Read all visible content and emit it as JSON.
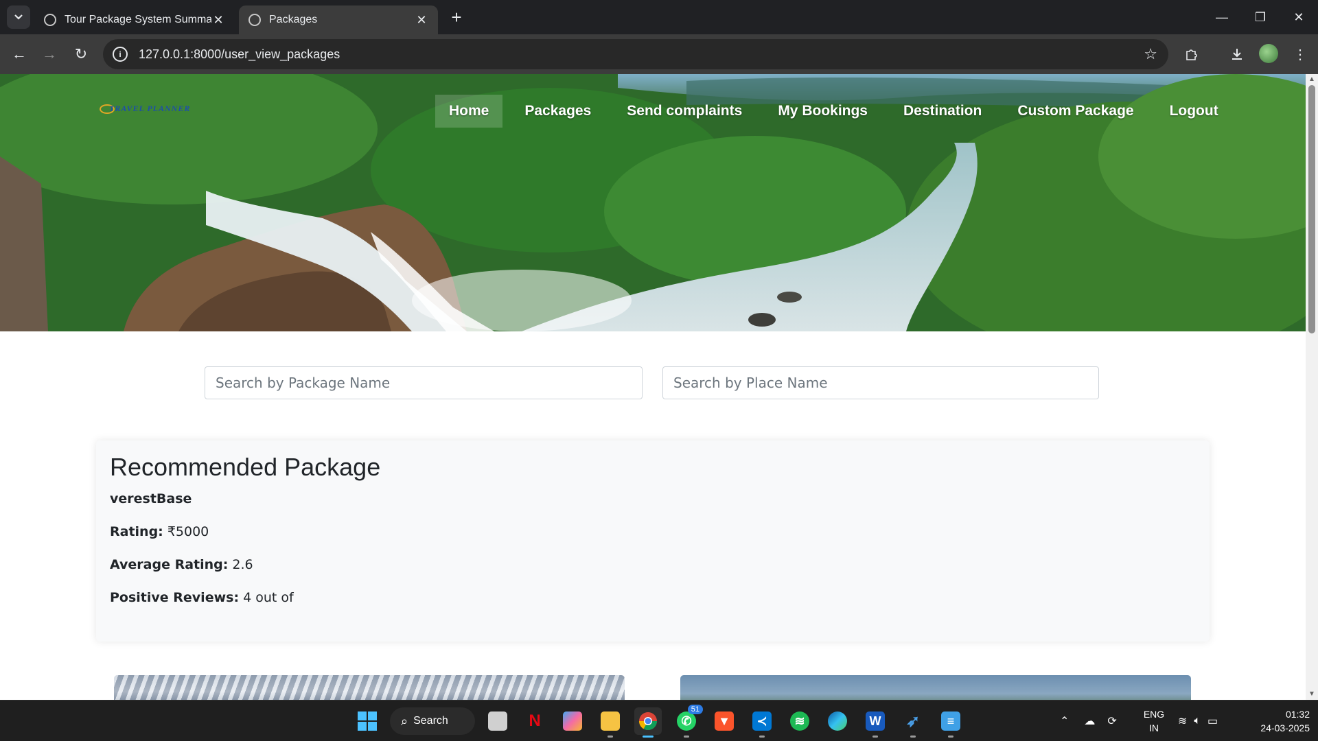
{
  "browser": {
    "tabs": [
      {
        "title": "Tour Package System Summary",
        "active": false
      },
      {
        "title": "Packages",
        "active": true
      }
    ],
    "url": "127.0.0.1:8000/user_view_packages",
    "icons": {
      "tab_list": "chevron-down-icon",
      "new_tab": "plus-icon",
      "back": "arrow-left-icon",
      "forward": "arrow-right-icon",
      "reload": "reload-icon",
      "site_info": "info-icon",
      "bookmark": "star-icon",
      "extensions": "puzzle-icon",
      "downloads": "download-icon",
      "menu": "kebab-menu-icon"
    }
  },
  "site": {
    "logo_text": "TRAVEL PLANNER",
    "nav": [
      {
        "label": "Home",
        "active": true
      },
      {
        "label": "Packages",
        "active": false
      },
      {
        "label": "Send complaints",
        "active": false
      },
      {
        "label": "My Bookings",
        "active": false
      },
      {
        "label": "Destination",
        "active": false
      },
      {
        "label": "Custom Package",
        "active": false
      },
      {
        "label": "Logout",
        "active": false
      }
    ],
    "search": {
      "package_placeholder": "Search by Package Name",
      "place_placeholder": "Search by Place Name",
      "package_value": "",
      "place_value": ""
    },
    "recommended": {
      "heading": "Recommended Package",
      "package_name": "verestBase",
      "rating_label": "Rating:",
      "rating_value": "₹5000",
      "avg_rating_label": "Average Rating:",
      "avg_rating_value": "2.6",
      "positive_label": "Positive Reviews:",
      "positive_value": "4 out of"
    }
  },
  "taskbar": {
    "search_label": "Search",
    "whatsapp_badge": "51",
    "language": {
      "line1": "ENG",
      "line2": "IN"
    },
    "time": "01:32",
    "date": "24-03-2025"
  },
  "colors": {
    "chrome_bg": "#202124",
    "toolbar_bg": "#3c3c3c",
    "card_bg": "#f8f9fa",
    "taskbar_bg": "#1f1f1f",
    "accent": "#4cc2ff"
  }
}
